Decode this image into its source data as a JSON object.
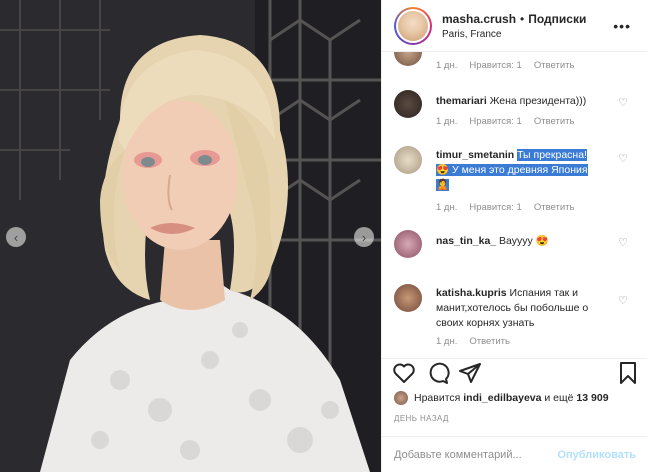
{
  "post": {
    "username": "masha.crush",
    "separator": "•",
    "follow_label": "Подписки",
    "location": "Paris, France"
  },
  "comments": [
    {
      "time": "1 дн.",
      "likes": "Нравится: 1",
      "reply": "Ответить"
    },
    {
      "user": "themariari",
      "text": "Жена президента)))",
      "time": "1 дн.",
      "likes": "Нравится: 1",
      "reply": "Ответить"
    },
    {
      "user": "timur_smetanin",
      "text_hl": "Ты прекрасна!",
      "emoji1": "😍",
      "text_line2": "У меня это древняя Япония",
      "time": "1 дн.",
      "likes": "Нравится: 1",
      "reply": "Ответить"
    },
    {
      "user": "nas_tin_ka_",
      "text": "Вауууу",
      "emoji": "😍"
    },
    {
      "user": "katisha.kupris",
      "text": "Испания так и манит,хотелось бы побольше о своих корнях узнать",
      "time": "1 дн.",
      "reply": "Ответить"
    }
  ],
  "likes_line": {
    "prefix": "Нравится",
    "user": "indi_edilbayeva",
    "middle": "и ещё",
    "count": "13 909"
  },
  "date": "ДЕНЬ НАЗАД",
  "compose": {
    "placeholder": "Добавьте комментарий...",
    "publish_label": "Опубликовать"
  },
  "icons": {
    "more": "more-options-icon",
    "heart": "heart-icon",
    "comment": "comment-icon",
    "share": "share-icon",
    "save": "bookmark-icon",
    "prev": "chevron-left-icon",
    "next": "chevron-right-icon"
  },
  "colors": {
    "publish_disabled": "#b2dffc",
    "highlight": "#3a7bd5",
    "muted": "#8e8e8e"
  }
}
